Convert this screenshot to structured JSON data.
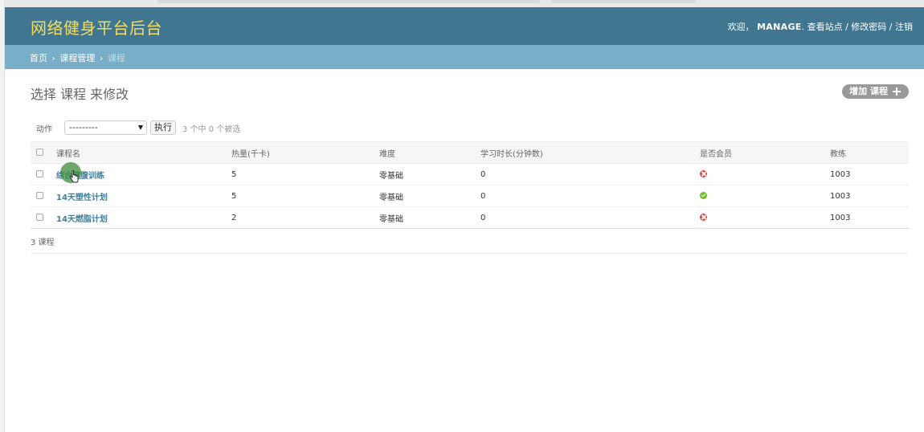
{
  "header": {
    "brand": "网络健身平台后台",
    "welcome": "欢迎，",
    "username": "MANAGE",
    "user_suffix": ".",
    "view_site": "查看站点",
    "sep1": " / ",
    "change_password": "修改密码",
    "sep2": " / ",
    "logout": "注销"
  },
  "breadcrumbs": {
    "home": "首页",
    "app": "课程管理",
    "current": "课程",
    "sep": "›"
  },
  "title": "选择 课程 来修改",
  "add_button": "增加 课程",
  "actions": {
    "label": "动作",
    "select_value": "---------",
    "go_label": "执行",
    "counter": "3 个中 0 个被选"
  },
  "table": {
    "columns": [
      "课程名",
      "热量(千卡)",
      "难度",
      "学习时长(分钟数)",
      "是否会员",
      "教练"
    ],
    "rows": [
      {
        "name": "综合健腹训练",
        "calories": "5",
        "difficulty": "零基础",
        "duration": "0",
        "member": "no",
        "coach": "1003"
      },
      {
        "name": "14天塑性计划",
        "calories": "5",
        "difficulty": "零基础",
        "duration": "0",
        "member": "yes",
        "coach": "1003"
      },
      {
        "name": "14天燃脂计划",
        "calories": "2",
        "difficulty": "零基础",
        "duration": "0",
        "member": "no",
        "coach": "1003"
      }
    ]
  },
  "paginator": "3 课程",
  "icons": {
    "false": "icon-no",
    "true": "icon-yes",
    "add": "plus-icon"
  },
  "colors": {
    "header_bg": "#417690",
    "brand": "#f5dd5d",
    "breadcrumb_bg": "#79aec8",
    "link": "#447e9b",
    "no": "#dd4646",
    "yes": "#70bf2b"
  }
}
